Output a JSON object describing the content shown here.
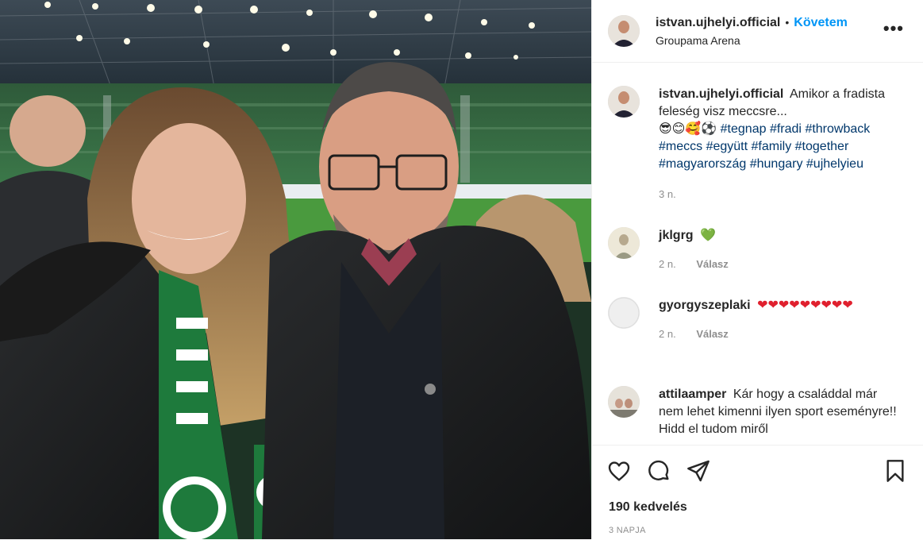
{
  "post": {
    "username": "istvan.ujhelyi.official",
    "follow_label": "Követem",
    "location": "Groupama Arena",
    "more_label": "•••"
  },
  "caption": {
    "username": "istvan.ujhelyi.official",
    "text": "Amikor a fradista feleség visz meccsre...",
    "emojis": "😎😊🥰⚽",
    "hashtags_line1": [
      "#tegnap",
      "#fradi",
      "#throwback"
    ],
    "hashtags_line2": [
      "#meccs",
      "#együtt",
      "#family",
      "#together"
    ],
    "hashtags_line3": [
      "#magyarország",
      "#hungary",
      "#ujhelyieu"
    ],
    "time": "3 n."
  },
  "comments": [
    {
      "username": "jklgrg",
      "text": "💚",
      "time": "2 n.",
      "reply": "Válasz"
    },
    {
      "username": "gyorgyszeplaki",
      "text": "❤❤❤❤❤❤❤❤❤",
      "time": "2 n.",
      "reply": "Válasz"
    },
    {
      "username": "attilaamper",
      "text": "Kár hogy a családdal már nem lehet kimenni ilyen sport eseményre!! Hidd el tudom miről"
    }
  ],
  "footer": {
    "likes": "190 kedvelés",
    "date": "3 NAPJA"
  },
  "icons": [
    "heart-icon",
    "comment-icon",
    "share-icon",
    "bookmark-icon"
  ],
  "colors": {
    "accent": "#0095f6",
    "hashtag": "#00376b",
    "muted": "#8e8e8e",
    "divider": "#efefef"
  }
}
